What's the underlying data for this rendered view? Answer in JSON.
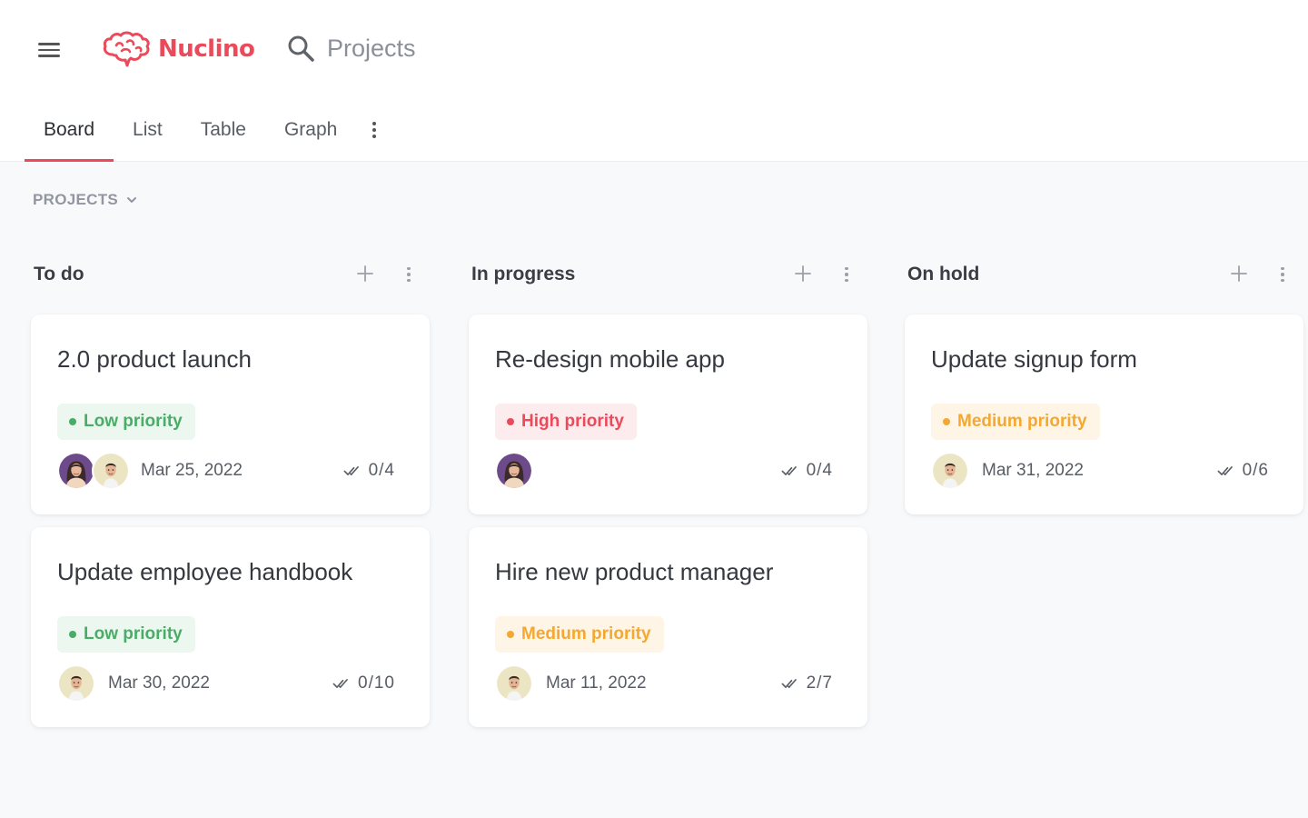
{
  "app": {
    "name": "Nuclino",
    "search_label": "Projects",
    "brand_color": "#ec4a5a"
  },
  "tabs": [
    {
      "label": "Board",
      "active": true
    },
    {
      "label": "List",
      "active": false
    },
    {
      "label": "Table",
      "active": false
    },
    {
      "label": "Graph",
      "active": false
    }
  ],
  "section": {
    "label": "PROJECTS"
  },
  "icons": {
    "menu": "hamburger-icon",
    "logo": "brain-icon",
    "search": "search-icon",
    "more": "vertical-dots-icon",
    "add": "plus-icon",
    "chevron": "chevron-down-icon",
    "tasks": "double-check-icon"
  },
  "priority_colors": {
    "low": "#4aad67",
    "high": "#ec4a5a",
    "medium": "#f4a831"
  },
  "columns": [
    {
      "title": "To do",
      "cards": [
        {
          "title": "2.0 product launch",
          "priority": "Low priority",
          "date": "Mar 25, 2022",
          "tasks": "0/4"
        },
        {
          "title": "Update employee handbook",
          "priority": "Low priority",
          "date": "Mar 30, 2022",
          "tasks": "0/10"
        }
      ]
    },
    {
      "title": "In progress",
      "cards": [
        {
          "title": "Re-design mobile app",
          "priority": "High priority",
          "date": "",
          "tasks": "0/4"
        },
        {
          "title": "Hire new product manager",
          "priority": "Medium priority",
          "date": "Mar 11, 2022",
          "tasks": "2/7"
        }
      ]
    },
    {
      "title": "On hold",
      "cards": [
        {
          "title": "Update signup form",
          "priority": "Medium priority",
          "date": "Mar 31, 2022",
          "tasks": "0/6"
        }
      ]
    }
  ]
}
